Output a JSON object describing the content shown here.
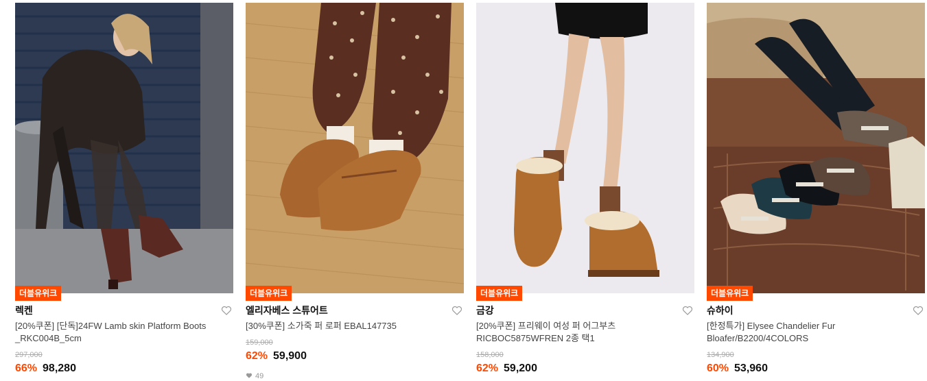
{
  "products": [
    {
      "badge": "더블유위크",
      "brand": "렉켄",
      "name_line1": "[20%쿠폰] [단독]24FW Lamb skin Platform Boots",
      "name_line2": "_RKC004B_5cm",
      "original_price": "297,000",
      "discount": "66%",
      "price": "98,280",
      "image_icon": "model-boots-photo",
      "colors": {
        "bg": "#3a4a66",
        "accent": "#5a3a2a"
      }
    },
    {
      "badge": "더블유위크",
      "brand": "엘리자베스 스튜어트",
      "name_line1": "[30%쿠폰] 소가죽 퍼 로퍼 EBAL147735",
      "name_line2": "",
      "original_price": "159,000",
      "discount": "62%",
      "price": "59,900",
      "likes": "49",
      "image_icon": "suede-loafer-photo",
      "colors": {
        "bg": "#c49a62",
        "accent": "#a0622c"
      }
    },
    {
      "badge": "더블유위크",
      "brand": "금강",
      "name_line1": "[20%쿠폰] 프리웨이 여성 퍼 어그부츠",
      "name_line2": "RICBOC5875WFREN 2종 택1",
      "original_price": "158,000",
      "discount": "62%",
      "price": "59,200",
      "image_icon": "fur-boots-photo",
      "colors": {
        "bg": "#eeecef",
        "accent": "#b06d2d"
      }
    },
    {
      "badge": "더블유위크",
      "brand": "슈하이",
      "name_line1": "[한정특가] Elysee Chandelier Fur",
      "name_line2": "Bloafer/B2200/4COLORS",
      "original_price": "134,900",
      "discount": "60%",
      "price": "53,960",
      "image_icon": "fur-bloafer-photo",
      "colors": {
        "bg": "#8a5a3a",
        "accent": "#1c2a33"
      }
    }
  ],
  "theme": {
    "discount_color": "#ff4800",
    "badge_color": "#ff4800"
  }
}
